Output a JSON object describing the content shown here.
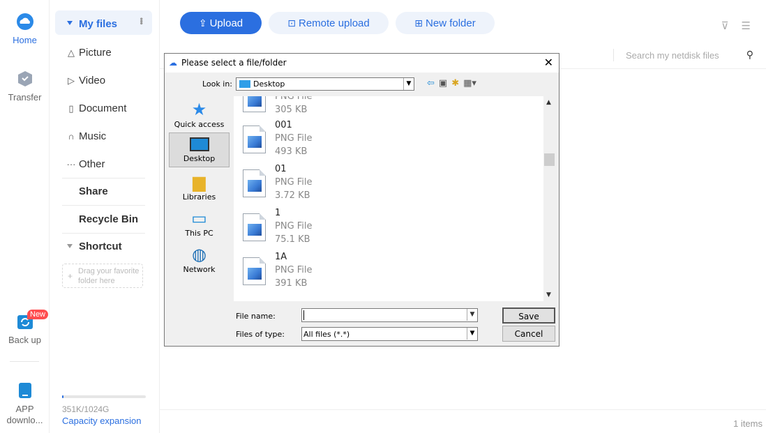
{
  "rail": {
    "home": "Home",
    "transfer": "Transfer",
    "backup": "Back up",
    "backup_badge": "New",
    "app_line1": "APP",
    "app_line2": "downlo..."
  },
  "sidebar": {
    "my_files": "My files",
    "items": [
      {
        "label": "Picture",
        "icon": "mountain-icon"
      },
      {
        "label": "Video",
        "icon": "play-icon"
      },
      {
        "label": "Document",
        "icon": "document-icon"
      },
      {
        "label": "Music",
        "icon": "headphones-icon"
      },
      {
        "label": "Other",
        "icon": "ellipsis-icon"
      }
    ],
    "share": "Share",
    "recycle_bin": "Recycle Bin",
    "shortcut": "Shortcut",
    "drag_hint_1": "Drag your favorite",
    "drag_hint_2": "folder here",
    "capacity_text": "351K/1024G",
    "capacity_used_fraction": 0.02,
    "capacity_link": "Capacity expansion"
  },
  "toolbar": {
    "upload": "Upload",
    "remote_upload": "Remote upload",
    "new_folder": "New folder"
  },
  "search": {
    "placeholder": "Search my netdisk files"
  },
  "footer": {
    "items_count": "1 items"
  },
  "dialog": {
    "title": "Please select a file/folder",
    "look_in_label": "Look in:",
    "look_in_value": "Desktop",
    "places": [
      "Quick access",
      "Desktop",
      "Libraries",
      "This PC",
      "Network"
    ],
    "files": [
      {
        "name": "",
        "type": "PNG File",
        "size": "305 KB"
      },
      {
        "name": "001",
        "type": "PNG File",
        "size": "493 KB"
      },
      {
        "name": "01",
        "type": "PNG File",
        "size": "3.72 KB"
      },
      {
        "name": "1",
        "type": "PNG File",
        "size": "75.1 KB"
      },
      {
        "name": "1A",
        "type": "PNG File",
        "size": "391 KB"
      }
    ],
    "file_name_label": "File name:",
    "file_name_value": "",
    "files_of_type_label": "Files of type:",
    "files_of_type_value": "All files (*.*)",
    "save": "Save",
    "cancel": "Cancel"
  }
}
